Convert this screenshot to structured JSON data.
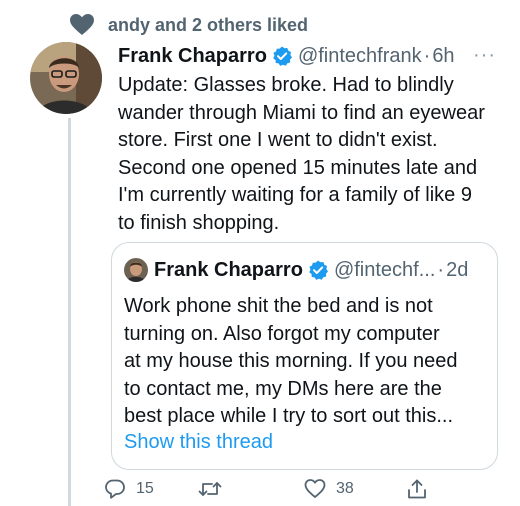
{
  "social_context": {
    "icon": "heart-icon",
    "text": "andy and 2 others liked"
  },
  "tweet": {
    "author_name": "Frank Chaparro",
    "handle": "@fintechfrank",
    "separator": "·",
    "time": "6h",
    "more": "···",
    "body_lines": [
      "Update: Glasses broke. Had to blindly",
      "wander through Miami to find an eyewear",
      "store. First one I went to didn't exist.",
      "Second one opened 15 minutes late and",
      "I'm currently waiting for a family of like 9",
      "to finish shopping."
    ]
  },
  "quoted": {
    "author_name": "Frank Chaparro",
    "handle": "@fintechf...",
    "separator": "·",
    "time": "2d",
    "body_lines": [
      "Work phone shit the bed and is not",
      "turning on. Also forgot my computer",
      "at my house this morning. If you need",
      "to contact me, my DMs here are the",
      "best place while I try to sort out this..."
    ],
    "show_thread": "Show this thread"
  },
  "actions": {
    "reply_count": "15",
    "retweet_count": "",
    "like_count": "38"
  },
  "colors": {
    "text": "#0f1419",
    "secondary": "#536471",
    "link": "#1d9bf0",
    "verified": "#1d9bf0",
    "border": "#cfd9de"
  }
}
